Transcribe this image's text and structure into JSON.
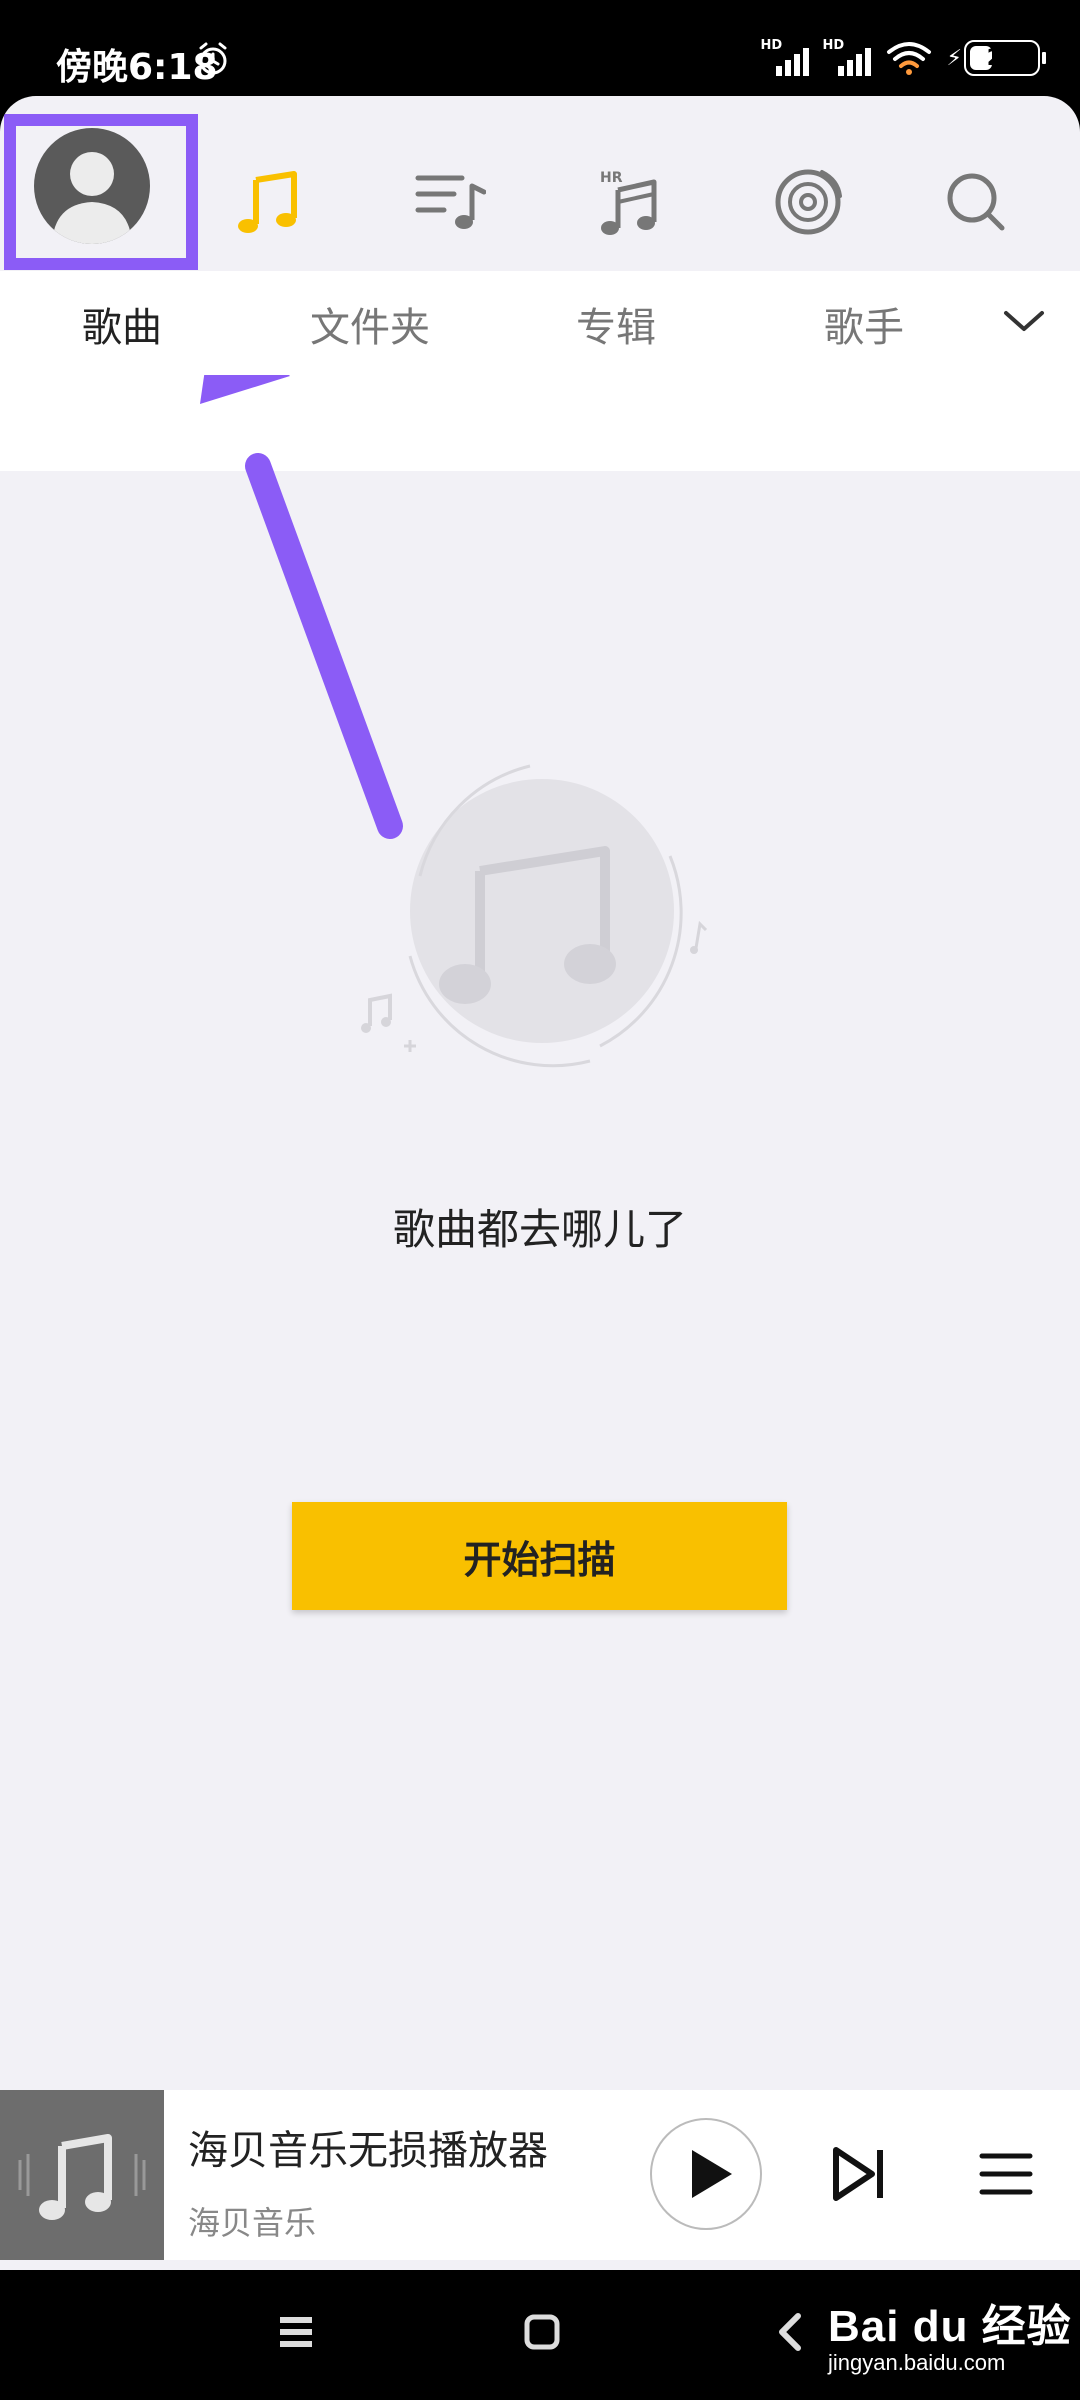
{
  "status": {
    "time": "傍晚6:18",
    "battery": "26",
    "sim1_tag": "HD",
    "sim2_tag": "HD"
  },
  "colors": {
    "accent": "#f9c000",
    "annotation": "#8b5cf6",
    "background": "#f2f1f6"
  },
  "nav": {
    "icons": [
      "avatar-icon",
      "music-note-icon",
      "playlist-icon",
      "hires-music-icon",
      "disc-radio-icon",
      "search-icon"
    ],
    "hr_badge": "HR"
  },
  "tabs": {
    "items": [
      "歌曲",
      "文件夹",
      "专辑",
      "歌手"
    ],
    "active_index": 0
  },
  "empty": {
    "message": "歌曲都去哪儿了",
    "scan_button": "开始扫描"
  },
  "player": {
    "title": "海贝音乐无损播放器",
    "subtitle": "海贝音乐"
  },
  "watermark": {
    "main": "Bai du 经验",
    "sub": "jingyan.baidu.com"
  }
}
